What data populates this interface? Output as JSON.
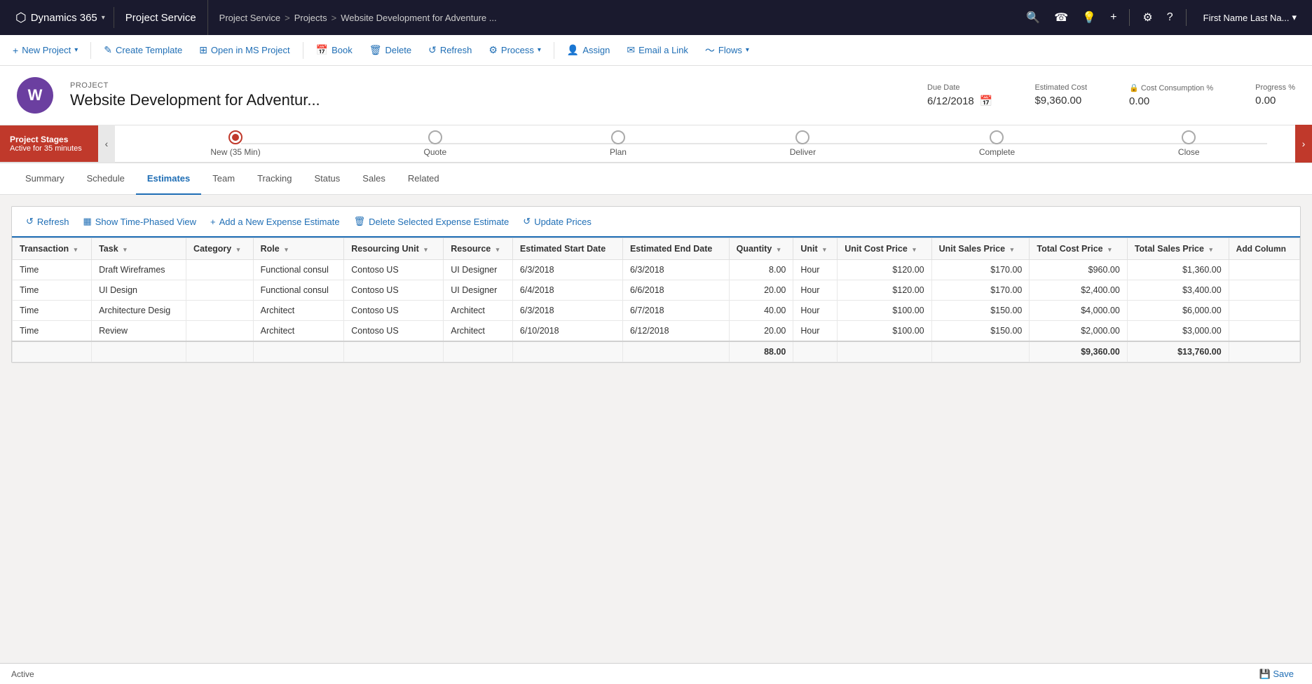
{
  "topNav": {
    "app": "Dynamics 365",
    "appDropdown": "▾",
    "module": "Project Service",
    "breadcrumb": [
      "Project Service",
      "Projects",
      "Website Development for Adventure ..."
    ],
    "breadcrumbSeps": [
      ">",
      ">"
    ],
    "icons": [
      "🔍",
      "☎",
      "💡",
      "+",
      "⚙",
      "?"
    ],
    "user": "First Name Last Na..."
  },
  "commandBar": {
    "buttons": [
      {
        "label": "New Project",
        "icon": "+",
        "hasDropdown": true
      },
      {
        "label": "Create Template",
        "icon": "✎"
      },
      {
        "label": "Open in MS Project",
        "icon": "⊞"
      },
      {
        "label": "Book",
        "icon": "📅"
      },
      {
        "label": "Delete",
        "icon": "🗑"
      },
      {
        "label": "Refresh",
        "icon": "↺"
      },
      {
        "label": "Process",
        "icon": "⚙",
        "hasDropdown": true
      },
      {
        "label": "Assign",
        "icon": "👤"
      },
      {
        "label": "Email a Link",
        "icon": "✉"
      },
      {
        "label": "Flows",
        "icon": "~",
        "hasDropdown": true
      }
    ]
  },
  "project": {
    "initials": "W",
    "label": "PROJECT",
    "name": "Website Development for Adventur...",
    "dueDate": {
      "label": "Due Date",
      "value": "6/12/2018"
    },
    "estimatedCost": {
      "label": "Estimated Cost",
      "value": "$9,360.00"
    },
    "costConsumption": {
      "label": "Cost Consumption %",
      "value": "0.00",
      "locked": true
    },
    "progress": {
      "label": "Progress %",
      "value": "0.00"
    }
  },
  "stages": {
    "label": "Project Stages",
    "sublabel": "Active for 35 minutes",
    "stages": [
      "New  (35 Min)",
      "Quote",
      "Plan",
      "Deliver",
      "Complete",
      "Close"
    ],
    "activeIndex": 0
  },
  "tabs": {
    "items": [
      "Summary",
      "Schedule",
      "Estimates",
      "Team",
      "Tracking",
      "Status",
      "Sales",
      "Related"
    ],
    "activeIndex": 2
  },
  "estimatesToolbar": {
    "buttons": [
      {
        "label": "Refresh",
        "icon": "↺"
      },
      {
        "label": "Show Time-Phased View",
        "icon": "▦"
      },
      {
        "label": "Add a New Expense Estimate",
        "icon": "+"
      },
      {
        "label": "Delete Selected Expense Estimate",
        "icon": "🗑"
      },
      {
        "label": "Update Prices",
        "icon": "↺"
      }
    ]
  },
  "grid": {
    "columns": [
      {
        "label": "Transaction",
        "key": "transaction"
      },
      {
        "label": "Task",
        "key": "task"
      },
      {
        "label": "Category",
        "key": "category"
      },
      {
        "label": "Role",
        "key": "role"
      },
      {
        "label": "Resourcing Unit",
        "key": "resourcingUnit"
      },
      {
        "label": "Resource",
        "key": "resource"
      },
      {
        "label": "Estimated Start Date",
        "key": "startDate"
      },
      {
        "label": "Estimated End Date",
        "key": "endDate"
      },
      {
        "label": "Quantity",
        "key": "quantity"
      },
      {
        "label": "Unit",
        "key": "unit"
      },
      {
        "label": "Unit Cost Price",
        "key": "unitCostPrice"
      },
      {
        "label": "Unit Sales Price",
        "key": "unitSalesPrice"
      },
      {
        "label": "Total Cost Price",
        "key": "totalCostPrice"
      },
      {
        "label": "Total Sales Price",
        "key": "totalSalesPrice"
      },
      {
        "label": "Add Column",
        "key": "addColumn",
        "isAction": true
      }
    ],
    "rows": [
      {
        "transaction": "Time",
        "task": "Draft Wireframes",
        "category": "",
        "role": "Functional consul",
        "resourcingUnit": "Contoso US",
        "resource": "UI Designer",
        "startDate": "6/3/2018",
        "endDate": "6/3/2018",
        "quantity": "8.00",
        "unit": "Hour",
        "unitCostPrice": "$120.00",
        "unitSalesPrice": "$170.00",
        "totalCostPrice": "$960.00",
        "totalSalesPrice": "$1,360.00"
      },
      {
        "transaction": "Time",
        "task": "UI Design",
        "category": "",
        "role": "Functional consul",
        "resourcingUnit": "Contoso US",
        "resource": "UI Designer",
        "startDate": "6/4/2018",
        "endDate": "6/6/2018",
        "quantity": "20.00",
        "unit": "Hour",
        "unitCostPrice": "$120.00",
        "unitSalesPrice": "$170.00",
        "totalCostPrice": "$2,400.00",
        "totalSalesPrice": "$3,400.00"
      },
      {
        "transaction": "Time",
        "task": "Architecture Desig",
        "category": "",
        "role": "Architect",
        "resourcingUnit": "Contoso US",
        "resource": "Architect",
        "startDate": "6/3/2018",
        "endDate": "6/7/2018",
        "quantity": "40.00",
        "unit": "Hour",
        "unitCostPrice": "$100.00",
        "unitSalesPrice": "$150.00",
        "totalCostPrice": "$4,000.00",
        "totalSalesPrice": "$6,000.00"
      },
      {
        "transaction": "Time",
        "task": "Review",
        "category": "",
        "role": "Architect",
        "resourcingUnit": "Contoso US",
        "resource": "Architect",
        "startDate": "6/10/2018",
        "endDate": "6/12/2018",
        "quantity": "20.00",
        "unit": "Hour",
        "unitCostPrice": "$100.00",
        "unitSalesPrice": "$150.00",
        "totalCostPrice": "$2,000.00",
        "totalSalesPrice": "$3,000.00"
      }
    ],
    "totals": {
      "quantity": "88.00",
      "totalCostPrice": "$9,360.00",
      "totalSalesPrice": "$13,760.00"
    }
  },
  "statusBar": {
    "status": "Active",
    "saveLabel": "💾 Save"
  }
}
